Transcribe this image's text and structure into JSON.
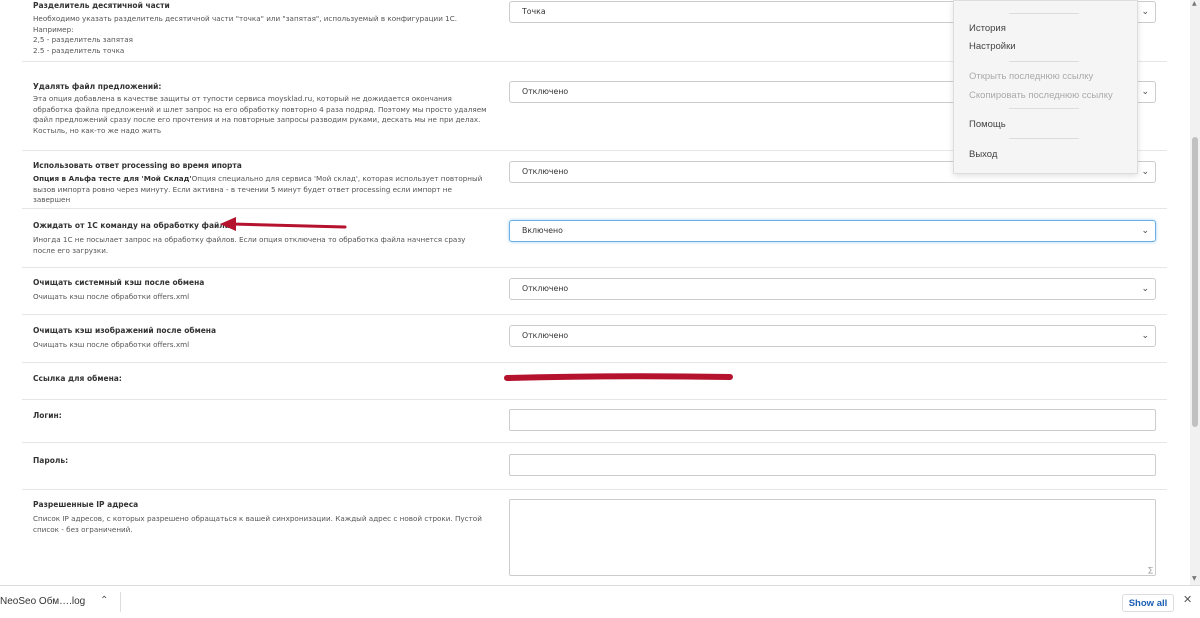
{
  "settings": {
    "decimal": {
      "label": "Разделитель десятичной части",
      "desc1": "Необходимо указать разделитель десятичной части \"точка\" или \"запятая\", используемый в конфигурации 1С.",
      "desc2": "Например:",
      "desc3": "2,5 - разделитель запятая",
      "desc4": "2.5 - разделитель точка",
      "value": "Точка"
    },
    "delete_offers": {
      "label": "Удалять файл предложений:",
      "desc": "Эта опция добавлена в качестве защиты от тупости сервиса moysklad.ru, который не дожидается окончания обработка файла предложений и шлет запрос на его обработку повторно 4 раза подряд. Поэтому мы просто удаляем файл предложений сразу после его прочтения и на повторные запросы разводим руками, дескать мы не при делах. Костыль, но как-то же надо жить",
      "value": "Отключено"
    },
    "processing": {
      "label": "Использовать ответ processing во время ипорта",
      "desc_bold": "Опция в Альфа тесте для 'Мой Склад'",
      "desc": "Опция специально для сервиса 'Мой склад', которая использует повторный вызов импорта ровно через минуту. Если активна - в течении 5 минут будет ответ processing если импорт не завершен",
      "value": "Отключено"
    },
    "wait_command": {
      "label": "Ожидать от 1С команду на обработку файла",
      "desc": "Иногда 1С не посылает запрос на обработку файлов. Если опция отключена то обработка файла начнется сразу после его загрузки.",
      "value": "Включено"
    },
    "clear_cache": {
      "label": "Очищать системный кэш после обмена",
      "desc": "Очищать кэш после обработки offers.xml",
      "value": "Отключено"
    },
    "clear_images": {
      "label": "Очищать кэш изображений после обмена",
      "desc": "Очищать кэш после обработки offers.xml",
      "value": "Отключено"
    },
    "exchange_link": {
      "label": "Ссылка для обмена:"
    },
    "login": {
      "label": "Логин:",
      "value": ""
    },
    "password": {
      "label": "Пароль:",
      "value": ""
    },
    "allowed_ip": {
      "label": "Разрешенные IP адреса",
      "desc": "Список IP адресов, с которых разрешено обращаться к вашей синхронизации. Каждый адрес с новой строки. Пустой список - без ограничений.",
      "value": ""
    }
  },
  "context_menu": {
    "history": "История",
    "settings": "Настройки",
    "open_last": "Открыть последнюю ссылку",
    "copy_last": "Скопировать последнюю ссылку",
    "help": "Помощь",
    "exit": "Выход"
  },
  "download_bar": {
    "file": "NeoSeo Обм….log",
    "show_all": "Show all"
  },
  "colors": {
    "annotation": "#b5122e",
    "focus_border": "#66afe9",
    "link_blue": "#1a5fb4"
  }
}
